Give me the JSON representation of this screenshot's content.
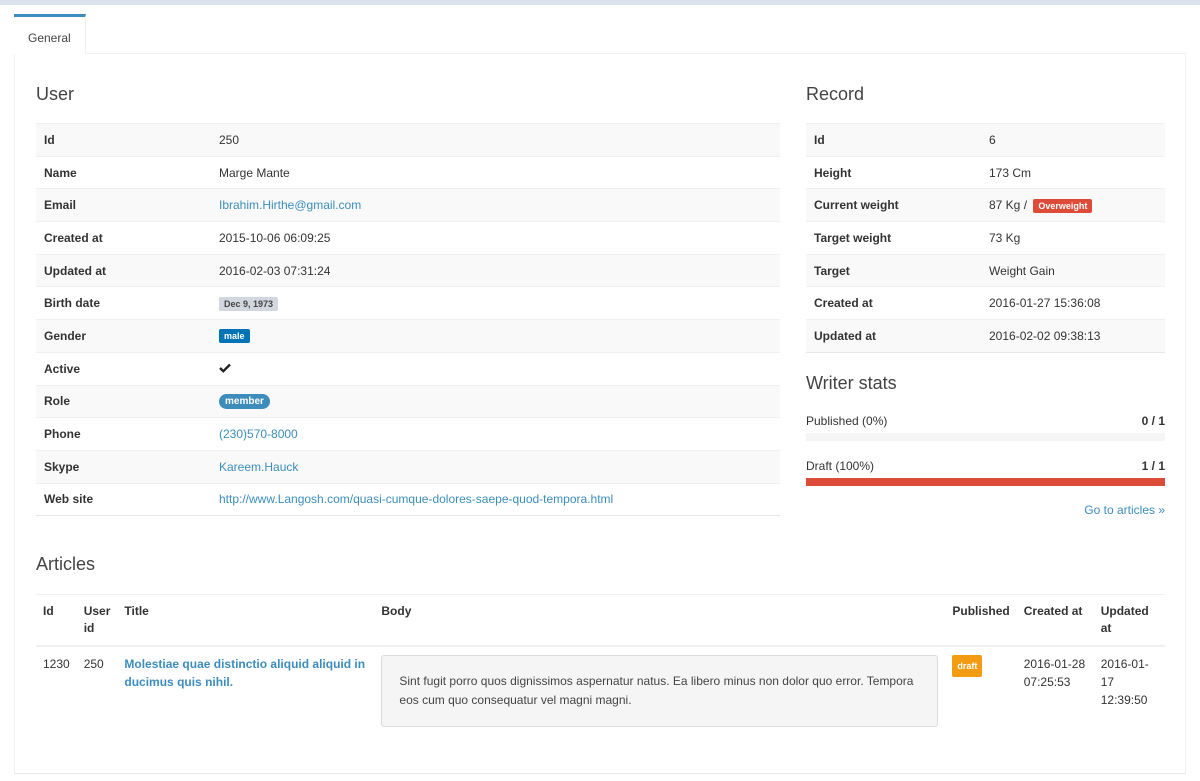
{
  "tabs": [
    {
      "label": "General"
    }
  ],
  "user": {
    "title": "User",
    "rows": [
      {
        "key": "Id",
        "value": "250"
      },
      {
        "key": "Name",
        "value": "Marge Mante"
      },
      {
        "key": "Email",
        "value": "Ibrahim.Hirthe@gmail.com"
      },
      {
        "key": "Created at",
        "value": "2015-10-06 06:09:25"
      },
      {
        "key": "Updated at",
        "value": "2016-02-03 07:31:24"
      },
      {
        "key": "Birth date",
        "value": "Dec 9, 1973"
      },
      {
        "key": "Gender",
        "value": "male"
      },
      {
        "key": "Active",
        "value_icon": "check-icon"
      },
      {
        "key": "Role",
        "value": "member"
      },
      {
        "key": "Phone",
        "value": "(230)570-8000"
      },
      {
        "key": "Skype",
        "value": "Kareem.Hauck"
      },
      {
        "key": "Web site",
        "value": "http://www.Langosh.com/quasi-cumque-dolores-saepe-quod-tempora.html"
      }
    ]
  },
  "record": {
    "title": "Record",
    "rows": [
      {
        "key": "Id",
        "value": "6"
      },
      {
        "key": "Height",
        "value": "173 Cm"
      },
      {
        "key": "Current weight",
        "value": "87 Kg /",
        "badge": "Overweight"
      },
      {
        "key": "Target weight",
        "value": "73 Kg"
      },
      {
        "key": "Target",
        "value": "Weight Gain"
      },
      {
        "key": "Created at",
        "value": "2016-01-27 15:36:08"
      },
      {
        "key": "Updated at",
        "value": "2016-02-02 09:38:13"
      }
    ]
  },
  "writer_stats": {
    "title": "Writer stats",
    "published": {
      "label": "Published (0%)",
      "value": "0 / 1",
      "fraction": 0
    },
    "draft": {
      "label": "Draft (100%)",
      "value": "1 / 1",
      "fraction": 1
    },
    "link": "Go to articles »"
  },
  "articles": {
    "title": "Articles",
    "headers": {
      "id": "Id",
      "user_id": "User id",
      "title": "Title",
      "body": "Body",
      "published": "Published",
      "created_at": "Created at",
      "updated_at": "Updated at"
    },
    "rows": [
      {
        "id": "1230",
        "user_id": "250",
        "title": "Molestiae quae distinctio aliquid aliquid in ducimus quis nihil.",
        "body": "Sint fugit porro quos dignissimos aspernatur natus. Ea libero minus non dolor quo error. Tempora eos cum quo consequatur vel magni magni.",
        "published": "draft",
        "created_at": "2016-01-28 07:25:53",
        "updated_at": "2016-01-17 12:39:50"
      }
    ]
  },
  "colors": {
    "accent": "#3c8dbc",
    "danger": "#dd4b39",
    "warning": "#f39c12",
    "primary_badge": "#0073b7"
  }
}
